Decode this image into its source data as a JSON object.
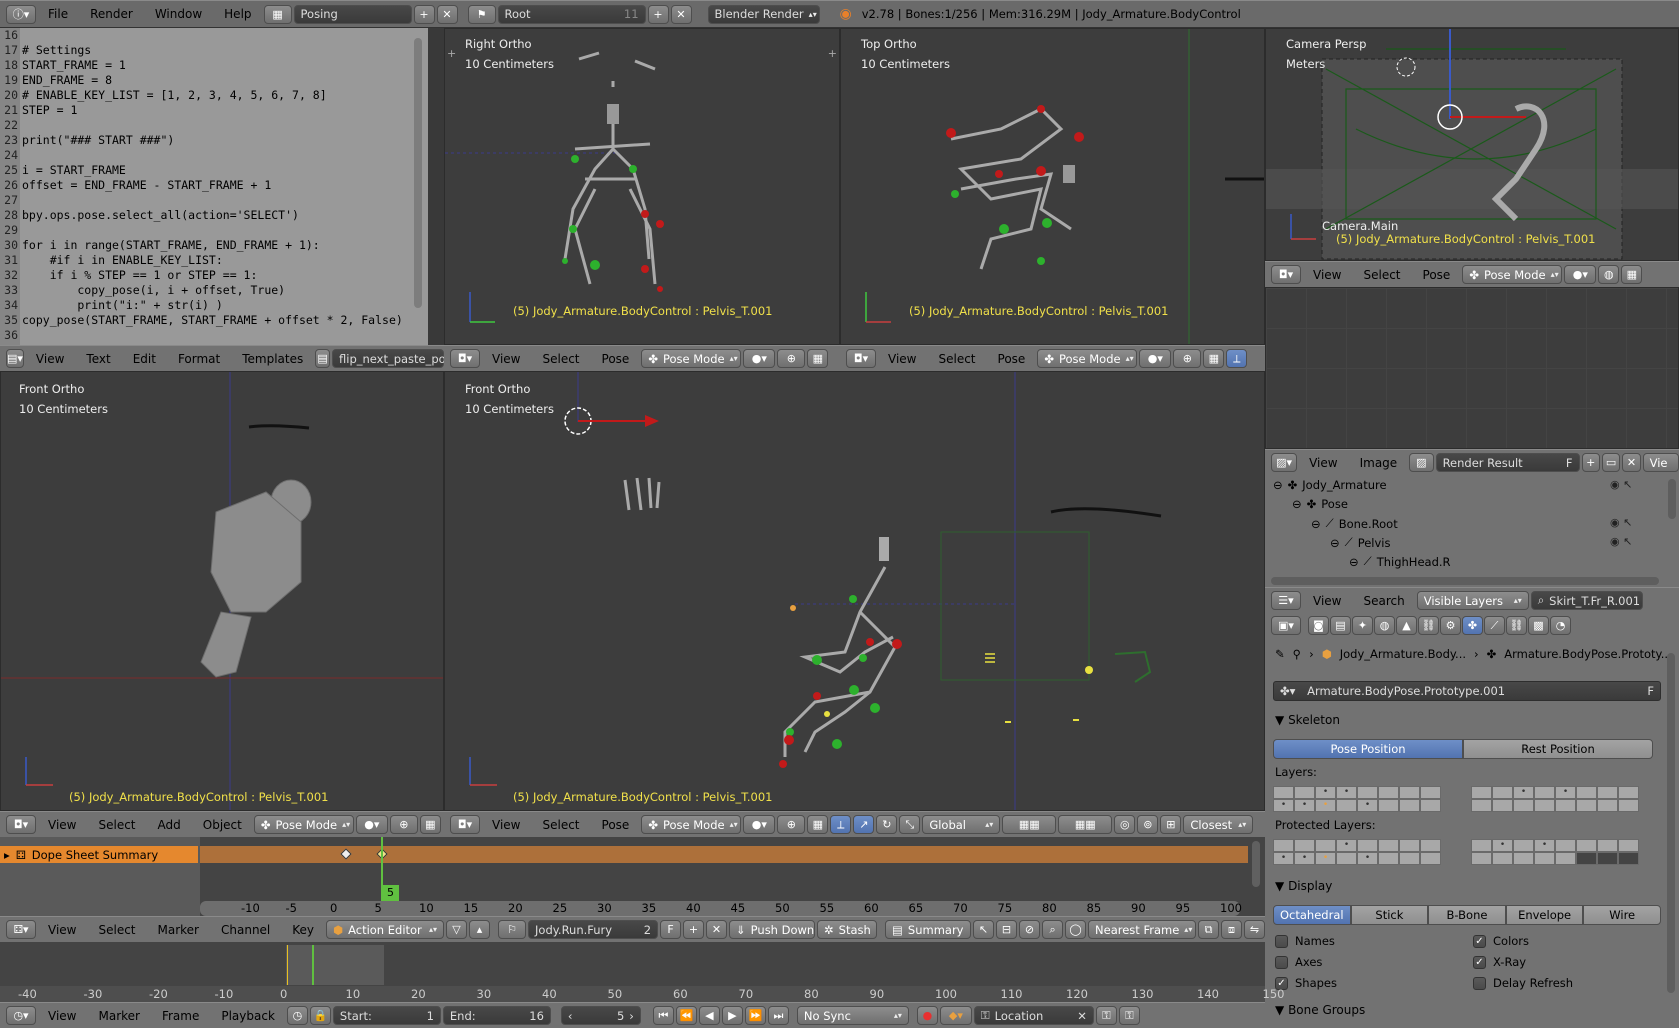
{
  "topbar": {
    "menus": [
      "File",
      "Render",
      "Window",
      "Help"
    ],
    "screen_layout": "Posing",
    "scene": "Root",
    "scene_users": "11",
    "engine": "Blender Render",
    "info": "v2.78 | Bones:1/256  | Mem:316.29M | Jody_Armature.BodyControl"
  },
  "text_editor": {
    "lines": [
      {
        "n": "16",
        "t": ""
      },
      {
        "n": "17",
        "t": "# Settings"
      },
      {
        "n": "18",
        "t": "START_FRAME = 1"
      },
      {
        "n": "19",
        "t": "END_FRAME = 8"
      },
      {
        "n": "20",
        "t": "# ENABLE_KEY_LIST = [1, 2, 3, 4, 5, 6, 7, 8]"
      },
      {
        "n": "21",
        "t": "STEP = 1"
      },
      {
        "n": "22",
        "t": ""
      },
      {
        "n": "23",
        "t": "print(\"### START ###\")"
      },
      {
        "n": "24",
        "t": ""
      },
      {
        "n": "25",
        "t": "i = START_FRAME"
      },
      {
        "n": "26",
        "t": "offset = END_FRAME - START_FRAME + 1"
      },
      {
        "n": "27",
        "t": ""
      },
      {
        "n": "28",
        "t": "bpy.ops.pose.select_all(action='SELECT')"
      },
      {
        "n": "29",
        "t": ""
      },
      {
        "n": "30",
        "t": "for i in range(START_FRAME, END_FRAME + 1):"
      },
      {
        "n": "31",
        "t": "    #if i in ENABLE_KEY_LIST:"
      },
      {
        "n": "32",
        "t": "    if i % STEP == 1 or STEP == 1:"
      },
      {
        "n": "33",
        "t": "        copy_pose(i, i + offset, True)"
      },
      {
        "n": "34",
        "t": "        print(\"i:\" + str(i) )"
      },
      {
        "n": "35",
        "t": "copy_pose(START_FRAME, START_FRAME + offset * 2, False)"
      },
      {
        "n": "36",
        "t": ""
      }
    ],
    "header": {
      "menus": [
        "View",
        "Text",
        "Edit",
        "Format",
        "Templates"
      ],
      "file": "flip_next_paste_pos..."
    }
  },
  "viewports": {
    "right": {
      "name": "Right Ortho",
      "scale": "10 Centimeters",
      "status": "(5) Jody_Armature.BodyControl : Pelvis_T.001"
    },
    "top": {
      "name": "Top Ortho",
      "scale": "10 Centimeters",
      "status": "(5) Jody_Armature.BodyControl : Pelvis_T.001"
    },
    "camera": {
      "name": "Camera Persp",
      "scale": "Meters",
      "camera_name": "Camera.Main",
      "status": "(5) Jody_Armature.BodyControl : Pelvis_T.001"
    },
    "front_left": {
      "name": "Front Ortho",
      "scale": "10 Centimeters",
      "status": "(5) Jody_Armature.BodyControl : Pelvis_T.001"
    },
    "front_main": {
      "name": "Front Ortho",
      "scale": "10 Centimeters",
      "status": "(5) Jody_Armature.BodyControl : Pelvis_T.001"
    }
  },
  "view3d_header": {
    "menus_pose": [
      "View",
      "Select",
      "Pose"
    ],
    "menus_object": [
      "View",
      "Select",
      "Add",
      "Object"
    ],
    "mode": "Pose Mode",
    "orientation": "Global",
    "snap": "Closest"
  },
  "image_editor": {
    "menus": [
      "View",
      "Image"
    ],
    "image": "Render Result",
    "flag": "F",
    "extra": "Vie"
  },
  "outliner": {
    "items": [
      {
        "label": "Jody_Armature",
        "indent": 0
      },
      {
        "label": "Pose",
        "indent": 1
      },
      {
        "label": "Bone.Root",
        "indent": 2
      },
      {
        "label": "Pelvis",
        "indent": 3
      },
      {
        "label": "ThighHead.R",
        "indent": 4
      }
    ],
    "header": {
      "menus": [
        "View",
        "Search"
      ],
      "filter": "Visible Layers",
      "search": "Skirt_T.Fr_R.001"
    }
  },
  "properties": {
    "breadcrumb": [
      "Jody_Armature.Body...",
      "Armature.BodyPose.Prototy..."
    ],
    "datablock": "Armature.BodyPose.Prototype.001",
    "datablock_flag": "F",
    "skeleton": {
      "title": "Skeleton",
      "pose_position": "Pose Position",
      "rest_position": "Rest Position",
      "layers": "Layers:",
      "protected": "Protected Layers:"
    },
    "display": {
      "title": "Display",
      "modes": [
        "Octahedral",
        "Stick",
        "B-Bone",
        "Envelope",
        "Wire"
      ],
      "selected_mode": "Octahedral",
      "names": "Names",
      "axes": "Axes",
      "shapes": "Shapes",
      "colors": "Colors",
      "xray": "X-Ray",
      "delay": "Delay Refresh"
    },
    "bone_groups": "Bone Groups"
  },
  "dopesheet": {
    "channel": "Dope Sheet Summary",
    "ruler": [
      "-10",
      "-5",
      "0",
      "5",
      "10",
      "15",
      "20",
      "25",
      "30",
      "35",
      "40",
      "45",
      "50",
      "55",
      "60",
      "65",
      "70",
      "75",
      "80",
      "85",
      "90",
      "95",
      "100"
    ],
    "current_frame": "5",
    "header": {
      "menus": [
        "View",
        "Select",
        "Marker",
        "Channel",
        "Key"
      ],
      "mode": "Action Editor",
      "action": "Jody.Run.Fury",
      "users": "2",
      "flag": "F",
      "push_down": "Push Down",
      "stash": "Stash",
      "summary": "Summary",
      "snap": "Nearest Frame"
    }
  },
  "timeline": {
    "ruler": [
      "-40",
      "-30",
      "-20",
      "-10",
      "0",
      "10",
      "20",
      "30",
      "40",
      "50",
      "60",
      "70",
      "80",
      "90",
      "100",
      "110",
      "120",
      "130",
      "140",
      "150"
    ],
    "header": {
      "menus": [
        "View",
        "Marker",
        "Frame",
        "Playback"
      ],
      "start_label": "Start:",
      "start": "1",
      "end_label": "End:",
      "end": "16",
      "current": "5",
      "sync": "No Sync",
      "keying": "Location"
    }
  },
  "colors": {
    "accent": "#5680c2",
    "status_yellow": "#f0e04a",
    "orange": "#e8a040"
  }
}
